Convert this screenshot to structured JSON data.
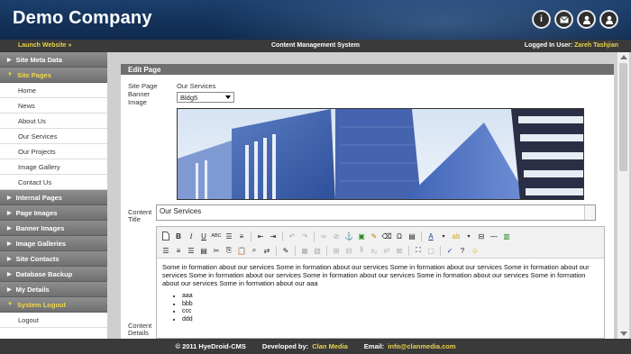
{
  "header": {
    "brand": "Demo Company",
    "icons": [
      "info-icon",
      "mail-icon",
      "user-icon",
      "logout-user-icon"
    ]
  },
  "topbar": {
    "launch": "Launch Website »",
    "center": "Content Management System",
    "user_label": "Logged In User:",
    "user_name": "Zareh Tashjian"
  },
  "sidebar": {
    "items": [
      {
        "label": "Site Meta Data",
        "type": "head"
      },
      {
        "label": "Site Pages",
        "type": "head-active"
      },
      {
        "label": "Home",
        "type": "sub"
      },
      {
        "label": "News",
        "type": "sub"
      },
      {
        "label": "About Us",
        "type": "sub"
      },
      {
        "label": "Our Services",
        "type": "sub"
      },
      {
        "label": "Our Projects",
        "type": "sub"
      },
      {
        "label": "Image Gallery",
        "type": "sub"
      },
      {
        "label": "Contact Us",
        "type": "sub"
      },
      {
        "label": "Internal Pages",
        "type": "head"
      },
      {
        "label": "Page Images",
        "type": "head"
      },
      {
        "label": "Banner Images",
        "type": "head"
      },
      {
        "label": "Image Galleries",
        "type": "head"
      },
      {
        "label": "Site Contacts",
        "type": "head"
      },
      {
        "label": "Database Backup",
        "type": "head"
      },
      {
        "label": "My Details",
        "type": "head"
      },
      {
        "label": "System Logout",
        "type": "head-active"
      },
      {
        "label": "Logout",
        "type": "sub"
      }
    ]
  },
  "panel": {
    "title": "Edit Page",
    "site_page_label": "Site Page",
    "site_page_value": "Our Services",
    "banner_label_1": "Banner",
    "banner_label_2": "Image",
    "banner_select": "Bldg5",
    "content_title_label_1": "Content",
    "content_title_label_2": "Title",
    "content_title_value": "Our Services",
    "content_details_label_1": "Content",
    "content_details_label_2": "Details"
  },
  "editor": {
    "paragraph": "Some in formation about our services Some in formation about our services Some in formation about our services Some in formation about our services Some in formation about our services Some in formation about our services Some in formation about our services Some in formation about our services Some in formation about our aaa",
    "bullets": [
      "aaa",
      "bbb",
      "ccc",
      "ddd"
    ]
  },
  "footer": {
    "copyright": "© 2011 HyeDroid-CMS",
    "developed_label": "Developed by:",
    "developer": "Clan Media",
    "email_label": "Email:",
    "email": "info@clanmedia.com"
  },
  "colors": {
    "header_blue": "#14325a",
    "accent_yellow": "#e8d24a",
    "menu_gray": "#7e7e7e",
    "bar_dark": "#3a3a3a"
  }
}
